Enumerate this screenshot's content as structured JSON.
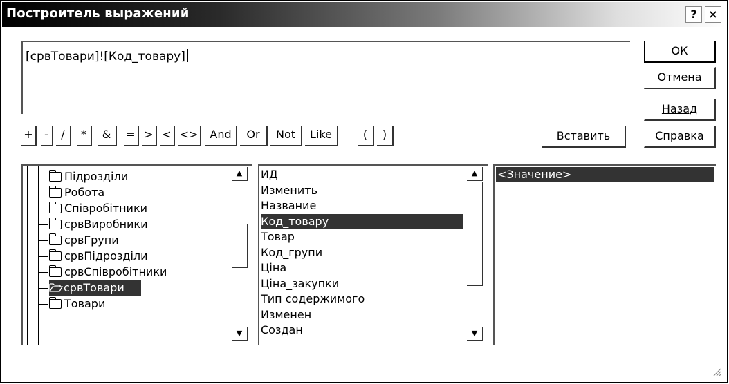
{
  "window": {
    "title": "Построитель выражений",
    "help_glyph": "?",
    "close_glyph": "×"
  },
  "expression": {
    "value": "[срвТовари]![Код_товару]"
  },
  "buttons": {
    "ok": "ОК",
    "cancel": "Отмена",
    "back": "Назад",
    "insert": "Вставить",
    "help": "Справка"
  },
  "operators": [
    "+",
    "-",
    "/",
    "*",
    "&",
    "=",
    ">",
    "<",
    "<>",
    "And",
    "Or",
    "Not",
    "Like",
    "(",
    ")"
  ],
  "tree": {
    "items": [
      {
        "label": "Підрозділи",
        "icon": "folder-closed-icon"
      },
      {
        "label": "Робота",
        "icon": "folder-closed-icon"
      },
      {
        "label": "Співробітники",
        "icon": "folder-closed-icon"
      },
      {
        "label": "срвВиробники",
        "icon": "folder-closed-icon"
      },
      {
        "label": "срвГрупи",
        "icon": "folder-closed-icon"
      },
      {
        "label": "срвПідрозділи",
        "icon": "folder-closed-icon"
      },
      {
        "label": "срвСпівробітники",
        "icon": "folder-closed-icon"
      },
      {
        "label": "срвТовари",
        "icon": "folder-open-icon",
        "selected": true
      },
      {
        "label": "Товари",
        "icon": "folder-closed-icon"
      }
    ]
  },
  "fields": {
    "items": [
      {
        "label": "ИД"
      },
      {
        "label": "Изменить"
      },
      {
        "label": "Название"
      },
      {
        "label": "Код_товару",
        "selected": true
      },
      {
        "label": "Товар"
      },
      {
        "label": "Код_групи"
      },
      {
        "label": "Ціна"
      },
      {
        "label": "Ціна_закупки"
      },
      {
        "label": "Тип содержимого"
      },
      {
        "label": "Изменен"
      },
      {
        "label": "Создан"
      }
    ]
  },
  "values": {
    "items": [
      {
        "label": "<Значение>",
        "selected": true
      }
    ]
  }
}
